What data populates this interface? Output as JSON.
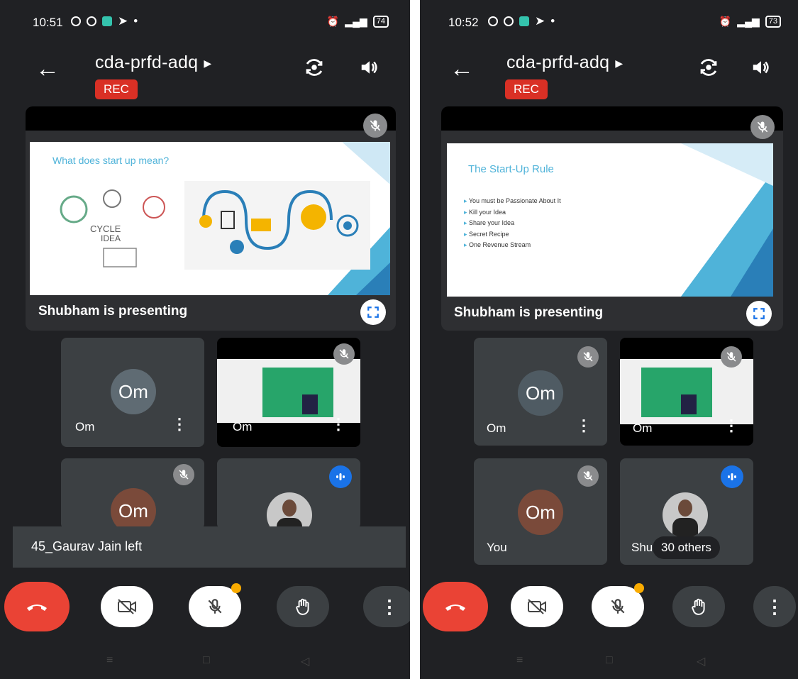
{
  "left": {
    "status": {
      "time": "10:51",
      "battery": "74"
    },
    "meeting_code": "cda-prfd-adq",
    "rec_label": "REC",
    "presenting_label": "Shubham is presenting",
    "slide_title": "What does start up mean?",
    "tiles": {
      "om1_initials": "Om",
      "om1_name": "Om",
      "om2_name": "Om",
      "om3_initials": "Om"
    },
    "toast": "45_Gaurav Jain left"
  },
  "right": {
    "status": {
      "time": "10:52",
      "battery": "73"
    },
    "meeting_code": "cda-prfd-adq",
    "rec_label": "REC",
    "presenting_label": "Shubham is presenting",
    "slide_title": "The Start-Up Rule",
    "slide_bullets": [
      "You must be Passionate About It",
      "Kill your Idea",
      "Share your Idea",
      "Secret Recipe",
      "One Revenue Stream"
    ],
    "tiles": {
      "om1_initials": "Om",
      "om1_name": "Om",
      "om2_name": "Om",
      "you_initials": "Om",
      "you_name": "You",
      "shu_name": "Shu"
    },
    "others": "30 others"
  },
  "colors": {
    "background": "#202124",
    "end_call": "#ea4335",
    "rec": "#d93025",
    "speaking": "#1a73e8"
  },
  "icons": [
    "back-arrow-icon",
    "switch-camera-icon",
    "speaker-icon",
    "mic-off-icon",
    "fullscreen-icon",
    "more-vert-icon",
    "audio-level-icon",
    "end-call-icon",
    "camera-off-icon",
    "raise-hand-icon"
  ]
}
